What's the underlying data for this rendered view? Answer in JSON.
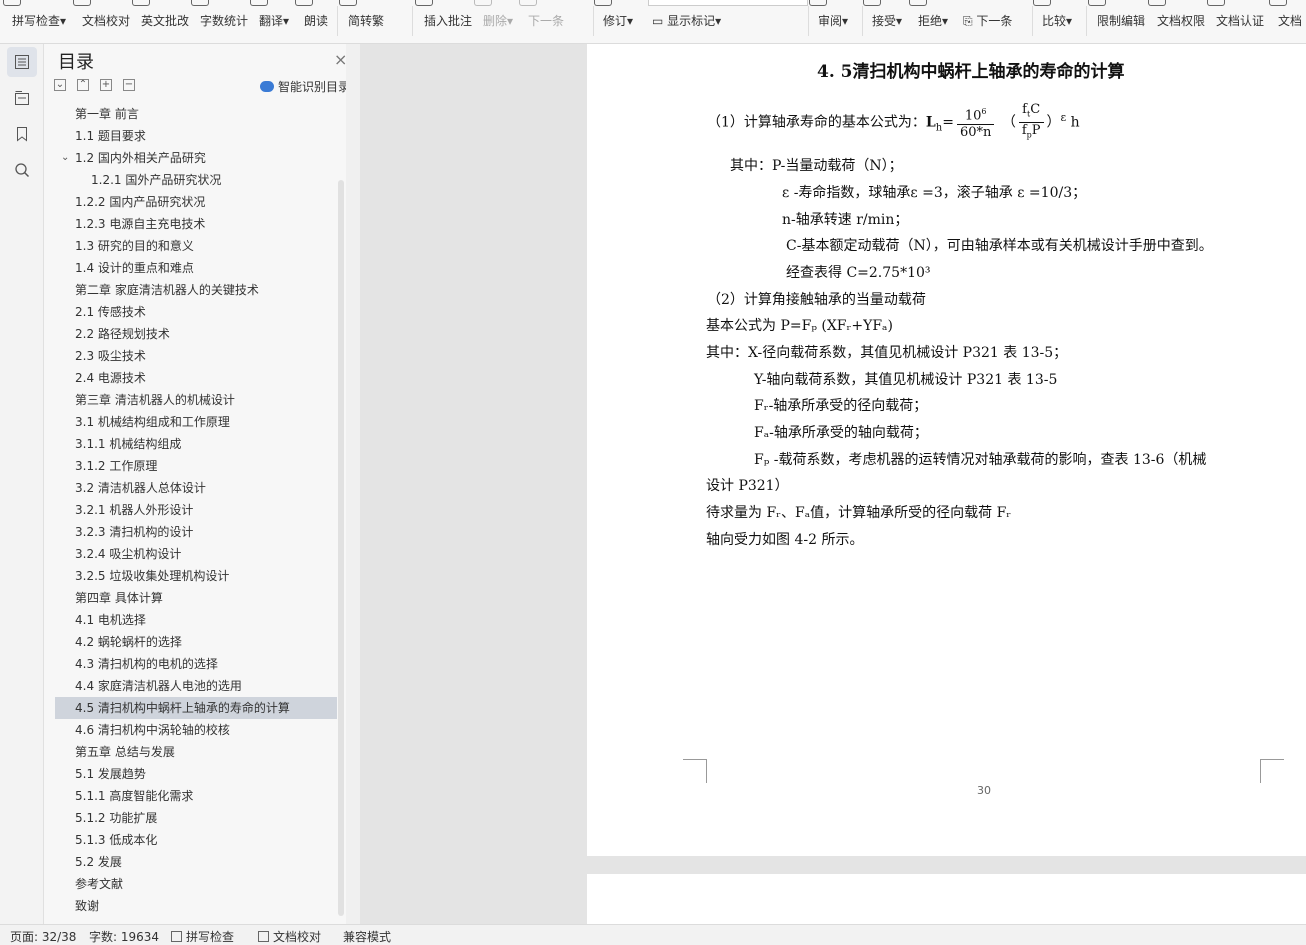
{
  "toolbar": {
    "items": [
      {
        "label": "拼写检查",
        "dropdown": "▾"
      },
      {
        "label": "文档校对"
      },
      {
        "label": "英文批改"
      },
      {
        "label": "字数统计"
      },
      {
        "label": "翻译",
        "dropdown": "▾"
      },
      {
        "label": "朗读"
      },
      {
        "label": "简转繁"
      },
      {
        "label": "插入批注"
      },
      {
        "label": "删除",
        "dropdown": "▾"
      },
      {
        "label": "下一条"
      },
      {
        "label": "修订",
        "dropdown": "▾"
      },
      {
        "label": "显示标记",
        "dropdown": "▾"
      },
      {
        "label": "审阅",
        "dropdown": "▾"
      },
      {
        "label": "接受",
        "dropdown": "▾"
      },
      {
        "label": "拒绝",
        "dropdown": "▾"
      },
      {
        "label": "下一条"
      },
      {
        "label": "比较",
        "dropdown": "▾"
      },
      {
        "label": "限制编辑"
      },
      {
        "label": "文档权限"
      },
      {
        "label": "文档认证"
      },
      {
        "label": "文档"
      }
    ]
  },
  "toc": {
    "title": "目录",
    "close": "×",
    "smart_label": "智能识别目录",
    "items": [
      {
        "text": "第一章  前言",
        "level": 1
      },
      {
        "text": "1.1 题目要求",
        "level": 2
      },
      {
        "text": "1.2 国内外相关产品研究",
        "level": 2,
        "expanded": "⌄"
      },
      {
        "text": "1.2.1 国外产品研究状况",
        "level": 3
      },
      {
        "text": "1.2.2 国内产品研究状况",
        "level": 2
      },
      {
        "text": "1.2.3 电源自主充电技术",
        "level": 2
      },
      {
        "text": "1.3 研究的目的和意义",
        "level": 2
      },
      {
        "text": "1.4 设计的重点和难点",
        "level": 2
      },
      {
        "text": "第二章  家庭清洁机器人的关键技术",
        "level": 1
      },
      {
        "text": "2.1 传感技术",
        "level": 2
      },
      {
        "text": "2.2 路径规划技术",
        "level": 2
      },
      {
        "text": "2.3 吸尘技术",
        "level": 2
      },
      {
        "text": "2.4 电源技术",
        "level": 2
      },
      {
        "text": "第三章  清洁机器人的机械设计",
        "level": 1
      },
      {
        "text": "3.1 机械结构组成和工作原理",
        "level": 2
      },
      {
        "text": "3.1.1   机械结构组成",
        "level": 2
      },
      {
        "text": "3.1.2 工作原理",
        "level": 2
      },
      {
        "text": "3.2 清洁机器人总体设计",
        "level": 2
      },
      {
        "text": "3.2.1 机器人外形设计",
        "level": 2
      },
      {
        "text": "3.2.3  清扫机构的设计",
        "level": 2
      },
      {
        "text": "3.2.4 吸尘机构设计",
        "level": 2
      },
      {
        "text": "3.2.5 垃圾收集处理机构设计",
        "level": 2
      },
      {
        "text": "第四章  具体计算",
        "level": 1
      },
      {
        "text": "4.1 电机选择",
        "level": 2
      },
      {
        "text": "4.2 蜗轮蜗杆的选择",
        "level": 2
      },
      {
        "text": "4.3 清扫机构的电机的选择",
        "level": 2
      },
      {
        "text": "4.4 家庭清洁机器人电池的选用",
        "level": 2
      },
      {
        "text": "4.5 清扫机构中蜗杆上轴承的寿命的计算",
        "level": 2,
        "active": true
      },
      {
        "text": "4.6  清扫机构中涡轮轴的校核",
        "level": 2
      },
      {
        "text": "第五章  总结与发展",
        "level": 1
      },
      {
        "text": "5.1 发展趋势",
        "level": 2
      },
      {
        "text": "5.1.1 高度智能化需求",
        "level": 2
      },
      {
        "text": "5.1.2 功能扩展",
        "level": 2
      },
      {
        "text": "5.1.3  低成本化",
        "level": 2
      },
      {
        "text": "5.2 发展",
        "level": 2
      },
      {
        "text": "参考文献",
        "level": 1
      },
      {
        "text": "致谢",
        "level": 1
      }
    ]
  },
  "document": {
    "heading": "4. 5清扫机构中蜗杆上轴承的寿命的计算",
    "formula": {
      "prefix": "（1）计算轴承寿命的基本公式为：",
      "lhs": "L",
      "lhs_sub": "h",
      "eq": "=",
      "frac1_num": "10",
      "frac1_num_sup": "6",
      "frac1_den": "60*n",
      "paren_open": "（",
      "frac2_num": "f",
      "frac2_num_sub": "t",
      "frac2_num_tail": "C",
      "frac2_den": "f",
      "frac2_den_sub": "p",
      "frac2_den_tail": "P",
      "paren_close": "）",
      "exp": "ε",
      "unit": "h"
    },
    "lines": [
      "其中：P-当量动载荷（N）；",
      "ε -寿命指数，球轴承ε =3，滚子轴承  ε =10/3；",
      "n-轴承转速 r/min；",
      "C-基本额定动载荷（N），可由轴承样本或有关机械设计手册中查到。",
      "经查表得 C=2.75*10³",
      "（2）计算角接触轴承的当量动载荷",
      "基本公式为 P=Fₚ (XFᵣ+YFₐ)",
      "其中：X-径向载荷系数，其值见机械设计 P321 表 13-5；",
      "Y-轴向载荷系数，其值见机械设计 P321 表 13-5",
      "Fᵣ-轴承所承受的径向载荷；",
      "Fₐ-轴承所承受的轴向载荷；",
      "Fₚ -载荷系数，考虑机器的运转情况对轴承载荷的影响，查表 13-6（机械",
      "设计 P321）",
      "待求量为 Fᵣ、Fₐ值，计算轴承所受的径向载荷 Fᵣ",
      "轴向受力如图 4-2 所示。"
    ],
    "page_number": "30"
  },
  "statusbar": {
    "page": "页面: 32/38",
    "words": "字数: 19634",
    "spellcheck": "拼写检查",
    "proofread": "文档校对",
    "compat": "兼容模式"
  }
}
